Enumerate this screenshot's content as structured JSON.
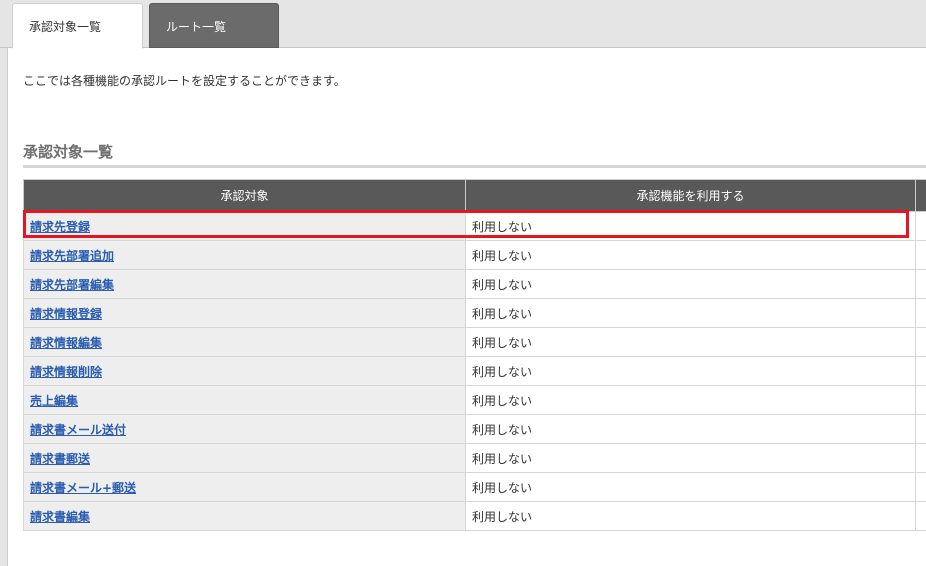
{
  "tabs": [
    {
      "label": "承認対象一覧",
      "active": true
    },
    {
      "label": "ルート一覧",
      "active": false
    }
  ],
  "intro_text": "ここでは各種機能の承認ルートを設定することができます。",
  "section_title": "承認対象一覧",
  "table": {
    "headers": [
      "承認対象",
      "承認機能を利用する"
    ],
    "rows": [
      {
        "name": "請求先登録",
        "value": "利用しない"
      },
      {
        "name": "請求先部署追加",
        "value": "利用しない"
      },
      {
        "name": "請求先部署編集",
        "value": "利用しない"
      },
      {
        "name": "請求情報登録",
        "value": "利用しない"
      },
      {
        "name": "請求情報編集",
        "value": "利用しない"
      },
      {
        "name": "請求情報削除",
        "value": "利用しない"
      },
      {
        "name": "売上編集",
        "value": "利用しない"
      },
      {
        "name": "請求書メール送付",
        "value": "利用しない"
      },
      {
        "name": "請求書郵送",
        "value": "利用しない"
      },
      {
        "name": "請求書メール+郵送",
        "value": "利用しない"
      },
      {
        "name": "請求書編集",
        "value": "利用しない"
      }
    ]
  },
  "colors": {
    "header_bg": "#595959",
    "link": "#2a5db0",
    "highlight": "#e8141f"
  }
}
